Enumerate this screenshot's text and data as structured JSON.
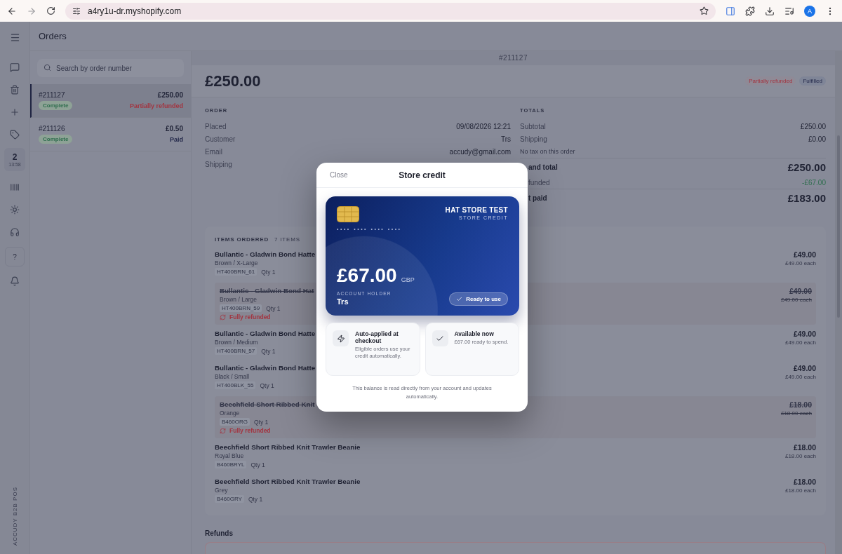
{
  "browser": {
    "url": "a4ry1u-dr.myshopify.com",
    "avatar": "A"
  },
  "rail": {
    "counter": "2",
    "time": "13:58",
    "help": "?",
    "brand": "ACCUDY B2B POS"
  },
  "header": {
    "title": "Orders"
  },
  "search": {
    "placeholder": "Search by order number"
  },
  "orders": [
    {
      "number": "#211127",
      "total": "£250.00",
      "status": "Complete",
      "payment": "Partially refunded",
      "color": "#a33440",
      "selected": true
    },
    {
      "number": "#211126",
      "total": "£0.50",
      "status": "Complete",
      "payment": "Paid",
      "color": "#23284a",
      "selected": false
    }
  ],
  "detail": {
    "number": "#211127",
    "total": "£250.00",
    "badges": [
      {
        "label": "Partially refunded",
        "kind": "refund"
      },
      {
        "label": "Fulfilled",
        "kind": "neutral"
      }
    ],
    "order_heading": "ORDER",
    "order_rows": [
      {
        "label": "Placed",
        "value": "09/08/2026 12:21"
      },
      {
        "label": "Customer",
        "value": "Trs"
      },
      {
        "label": "Email",
        "value": "accudy@gmail.com"
      },
      {
        "label": "Shipping"
      }
    ],
    "totals_heading": "TOTALS",
    "totals": [
      {
        "kind": "row",
        "label": "Subtotal",
        "value": "£250.00"
      },
      {
        "kind": "row",
        "label": "Shipping",
        "value": "£0.00"
      },
      {
        "kind": "note",
        "label": "No tax on this order"
      },
      {
        "kind": "grand",
        "label": "and total",
        "value": "£250.00",
        "partly_hidden": true
      },
      {
        "kind": "refund",
        "label": "funded",
        "value": "-£67.00",
        "partly_hidden": true
      },
      {
        "kind": "grand",
        "label": "t paid",
        "value": "£183.00",
        "partly_hidden": true
      }
    ],
    "items_heading": "ITEMS ORDERED",
    "items_count": "7 ITEMS",
    "items": [
      {
        "name": "Bullantic - Gladwin Bond Hatte",
        "variant": "Brown / X-Large",
        "sku": "HT400BRN_61",
        "qty": "Qty 1",
        "price": "£49.00",
        "each": "£49.00 each",
        "refunded": false
      },
      {
        "name": "Bullantic - Gladwin Bond Hat",
        "variant": "Brown / Large",
        "sku": "HT400BRN_59",
        "qty": "Qty 1",
        "price": "£49.00",
        "each": "£49.00 each",
        "refunded": true,
        "note": "Fully refunded"
      },
      {
        "name": "Bullantic - Gladwin Bond Hatte",
        "variant": "Brown / Medium",
        "sku": "HT400BRN_57",
        "qty": "Qty 1",
        "price": "£49.00",
        "each": "£49.00 each",
        "refunded": false
      },
      {
        "name": "Bullantic - Gladwin Bond Hatte",
        "variant": "Black / Small",
        "sku": "HT400BLK_55",
        "qty": "Qty 1",
        "price": "£49.00",
        "each": "£49.00 each",
        "refunded": false
      },
      {
        "name": "Beechfield Short Ribbed Knit",
        "variant": "Orange",
        "sku": "B460ORG",
        "qty": "Qty 1",
        "price": "£18.00",
        "each": "£18.00 each",
        "refunded": true,
        "note": "Fully refunded"
      },
      {
        "name": "Beechfield Short Ribbed Knit Trawler Beanie",
        "variant": "Royal Blue",
        "sku": "B460BRYL",
        "qty": "Qty 1",
        "price": "£18.00",
        "each": "£18.00 each",
        "refunded": false
      },
      {
        "name": "Beechfield Short Ribbed Knit Trawler Beanie",
        "variant": "Grey",
        "sku": "B460GRY",
        "qty": "Qty 1",
        "price": "£18.00",
        "each": "£18.00 each",
        "refunded": false
      }
    ],
    "refunds_heading": "Refunds"
  },
  "modal": {
    "close": "Close",
    "title": "Store credit",
    "card": {
      "store": "HAT STORE TEST",
      "subtitle": "STORE CREDIT",
      "masked": "•••• •••• •••• ••••",
      "amount": "£67.00",
      "currency": "GBP",
      "holder_label": "ACCOUNT HOLDER",
      "holder": "Trs",
      "status": "Ready to use"
    },
    "features": [
      {
        "kind": "bolt",
        "title": "Auto-applied at checkout",
        "text": "Eligible orders use your credit automatically."
      },
      {
        "kind": "check",
        "title": "Available now",
        "text": "£67.00 ready to spend."
      }
    ],
    "footer": "This balance is read directly from your account and updates automatically."
  }
}
